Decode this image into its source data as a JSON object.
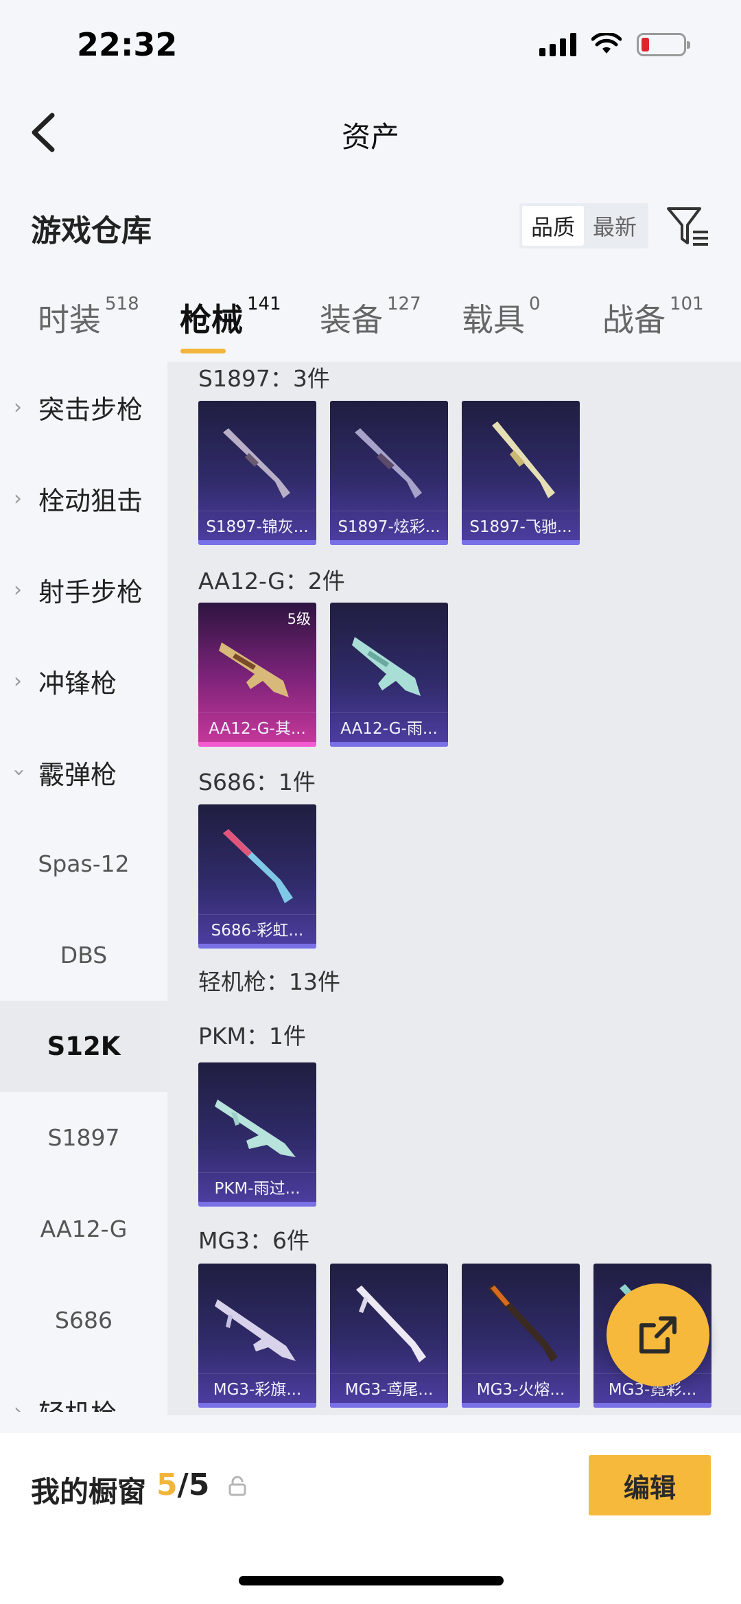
{
  "status_bar": {
    "time": "22:32"
  },
  "nav": {
    "title": "资产"
  },
  "warehouse": {
    "title": "游戏仓库",
    "sort_options": [
      "品质",
      "最新"
    ]
  },
  "tabs": [
    {
      "label": "时装",
      "count": "518"
    },
    {
      "label": "枪械",
      "count": "141"
    },
    {
      "label": "装备",
      "count": "127"
    },
    {
      "label": "载具",
      "count": "0"
    },
    {
      "label": "战备",
      "count": "101"
    }
  ],
  "sidebar": {
    "items": [
      {
        "label": "突击步枪"
      },
      {
        "label": "栓动狙击"
      },
      {
        "label": "射手步枪"
      },
      {
        "label": "冲锋枪"
      },
      {
        "label": "霰弹枪"
      },
      {
        "label": "Spas-12"
      },
      {
        "label": "DBS"
      },
      {
        "label": "S12K"
      },
      {
        "label": "S1897"
      },
      {
        "label": "AA12-G"
      },
      {
        "label": "S686"
      },
      {
        "label": "轻机枪"
      }
    ]
  },
  "content": {
    "headers": {
      "s1897": "S1897：3件",
      "aa12g": "AA12-G：2件",
      "s686": "S686：1件",
      "lmg": "轻机枪：13件",
      "pkm": "PKM：1件",
      "mg3": "MG3：6件"
    },
    "cards": {
      "s1897_1": "S1897-锦灰...",
      "s1897_2": "S1897-炫彩...",
      "s1897_3": "S1897-飞驰...",
      "aa12g_1": "AA12-G-其...",
      "aa12g_1_badge": "5级",
      "aa12g_2": "AA12-G-雨...",
      "s686_1": "S686-彩虹...",
      "pkm_1": "PKM-雨过...",
      "mg3_1": "MG3-彩旗...",
      "mg3_2": "MG3-鸢尾...",
      "mg3_3": "MG3-火熔...",
      "mg3_4": "MG3-霓彩..."
    }
  },
  "bottom": {
    "showcase_label": "我的橱窗",
    "showcase_current": "5",
    "showcase_total": "/5",
    "edit_label": "编辑"
  },
  "colors": {
    "accent": "#f6b93b",
    "card_purple": "#302b6a",
    "card_pink": "#c9399c"
  }
}
